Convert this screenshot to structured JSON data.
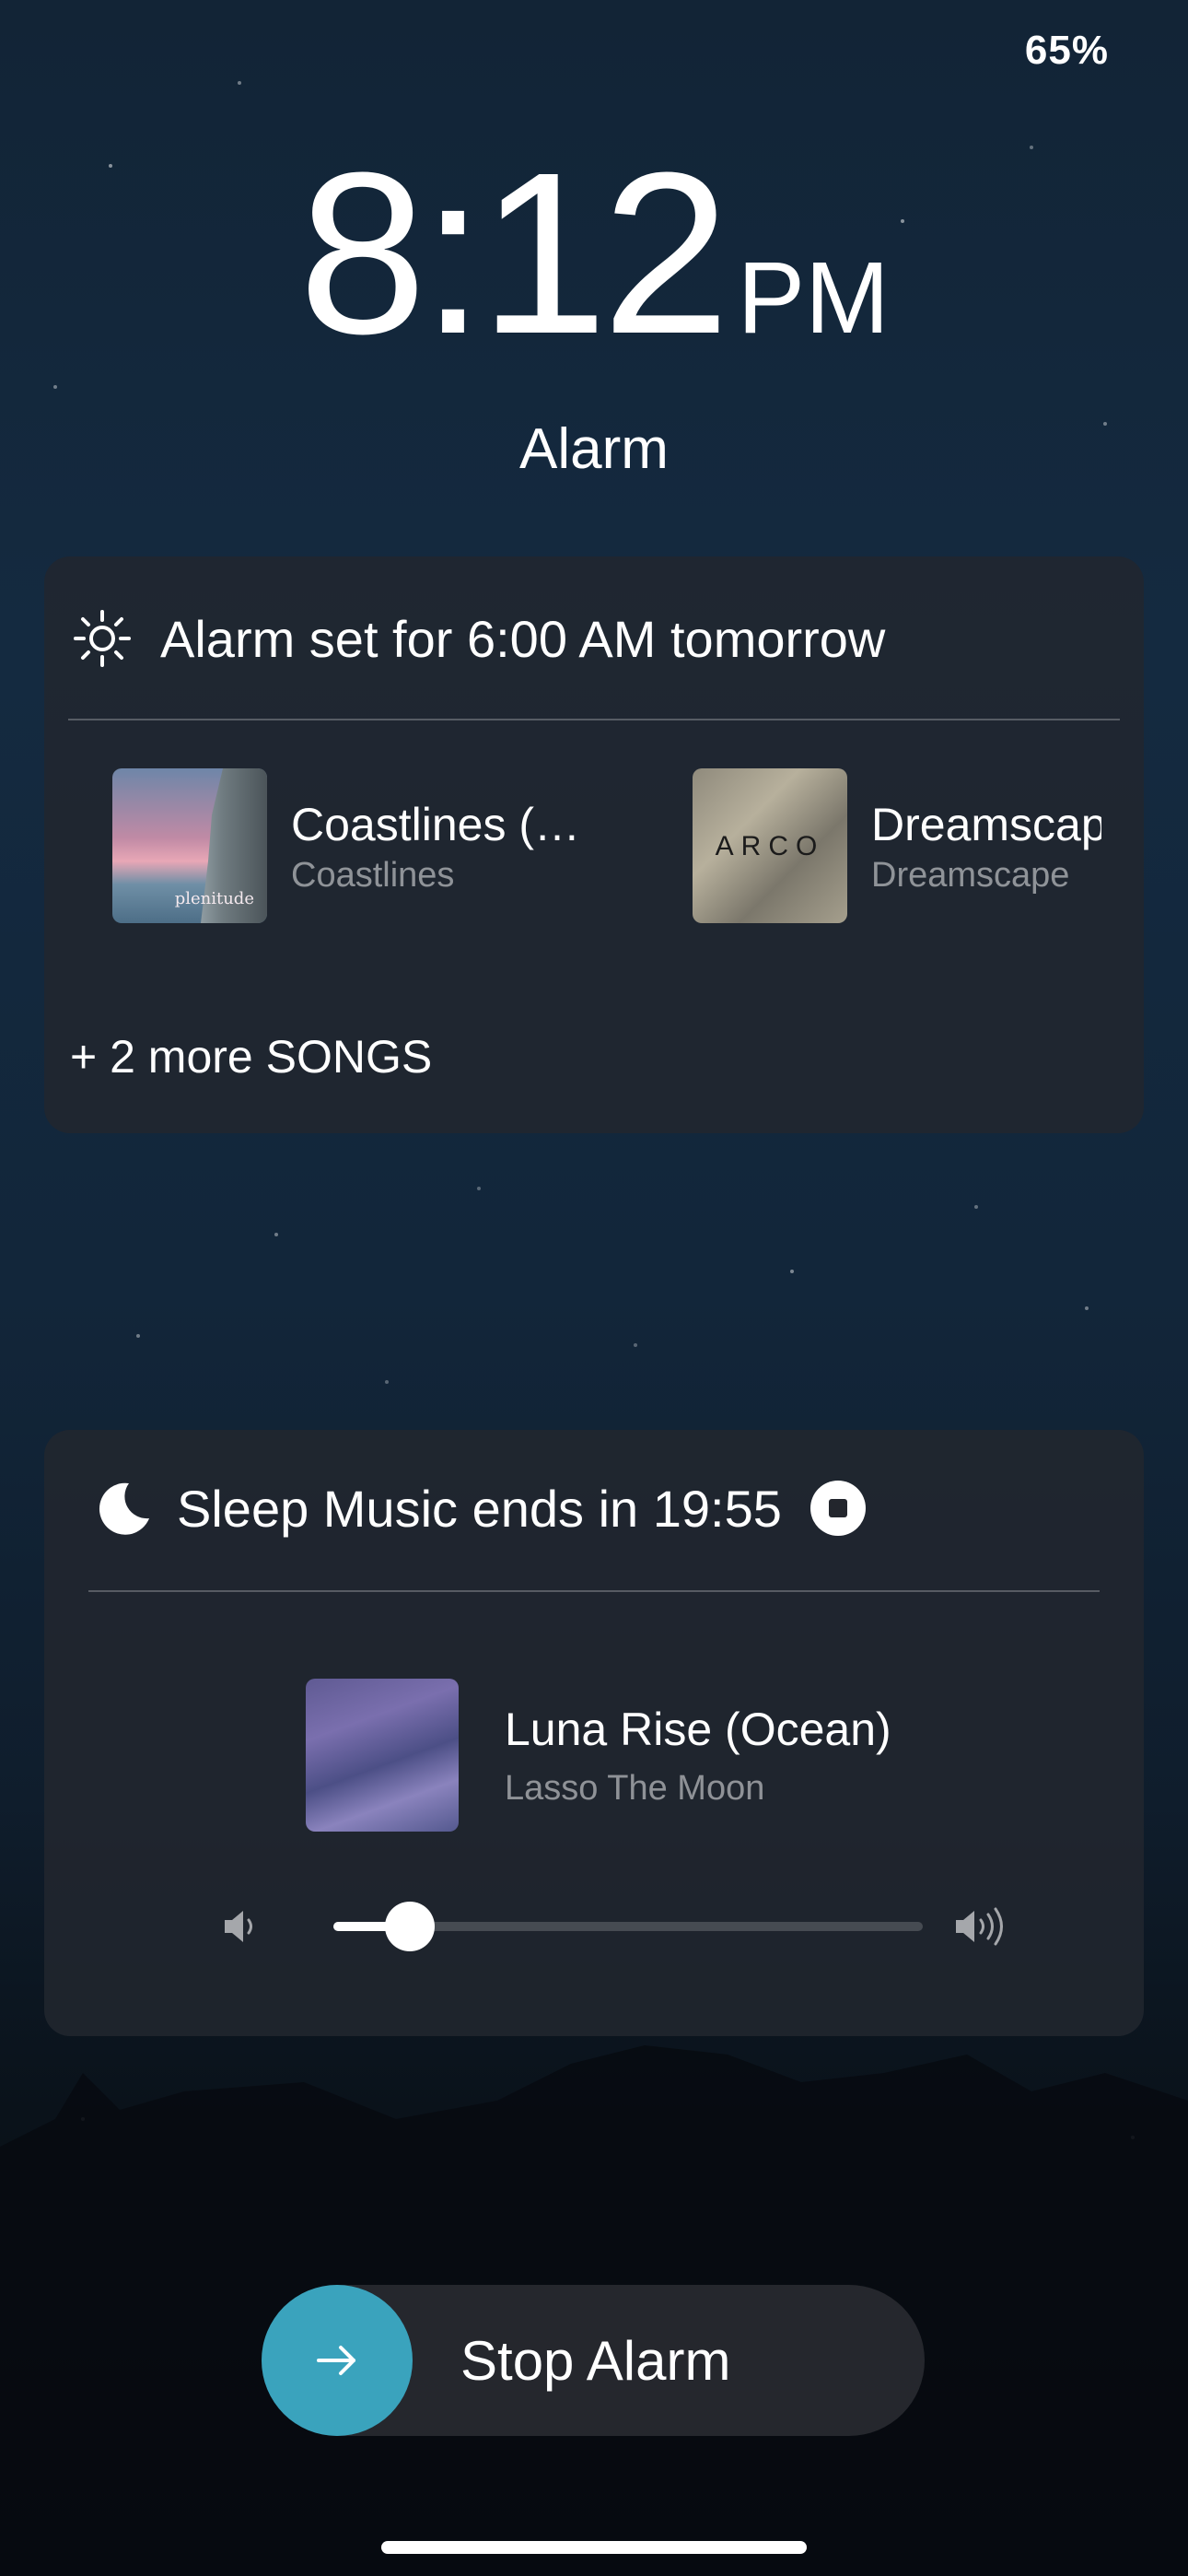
{
  "status": {
    "battery": "65%"
  },
  "clock": {
    "time": "8:12",
    "ampm": "PM",
    "label": "Alarm"
  },
  "alarm_card": {
    "header": "Alarm set for 6:00 AM tomorrow",
    "header_icon": "sun-icon",
    "songs": [
      {
        "title": "Coastlines (Nat...",
        "artist": "Coastlines",
        "art_text": "plenitude"
      },
      {
        "title": "Dreamscape",
        "artist": "Dreamscape",
        "art_text": "ARCO"
      }
    ],
    "more": "+ 2 more SONGS"
  },
  "sleep_card": {
    "header": "Sleep Music ends in 19:55",
    "header_icon": "moon-icon",
    "stop_icon": "stop-circle-icon",
    "track": {
      "title": "Luna Rise (Ocean)",
      "artist": "Lasso The Moon"
    },
    "volume_level": 0.13
  },
  "stop_alarm": {
    "label": "Stop Alarm",
    "icon": "arrow-right-icon",
    "accent": "#3aa3bd"
  }
}
